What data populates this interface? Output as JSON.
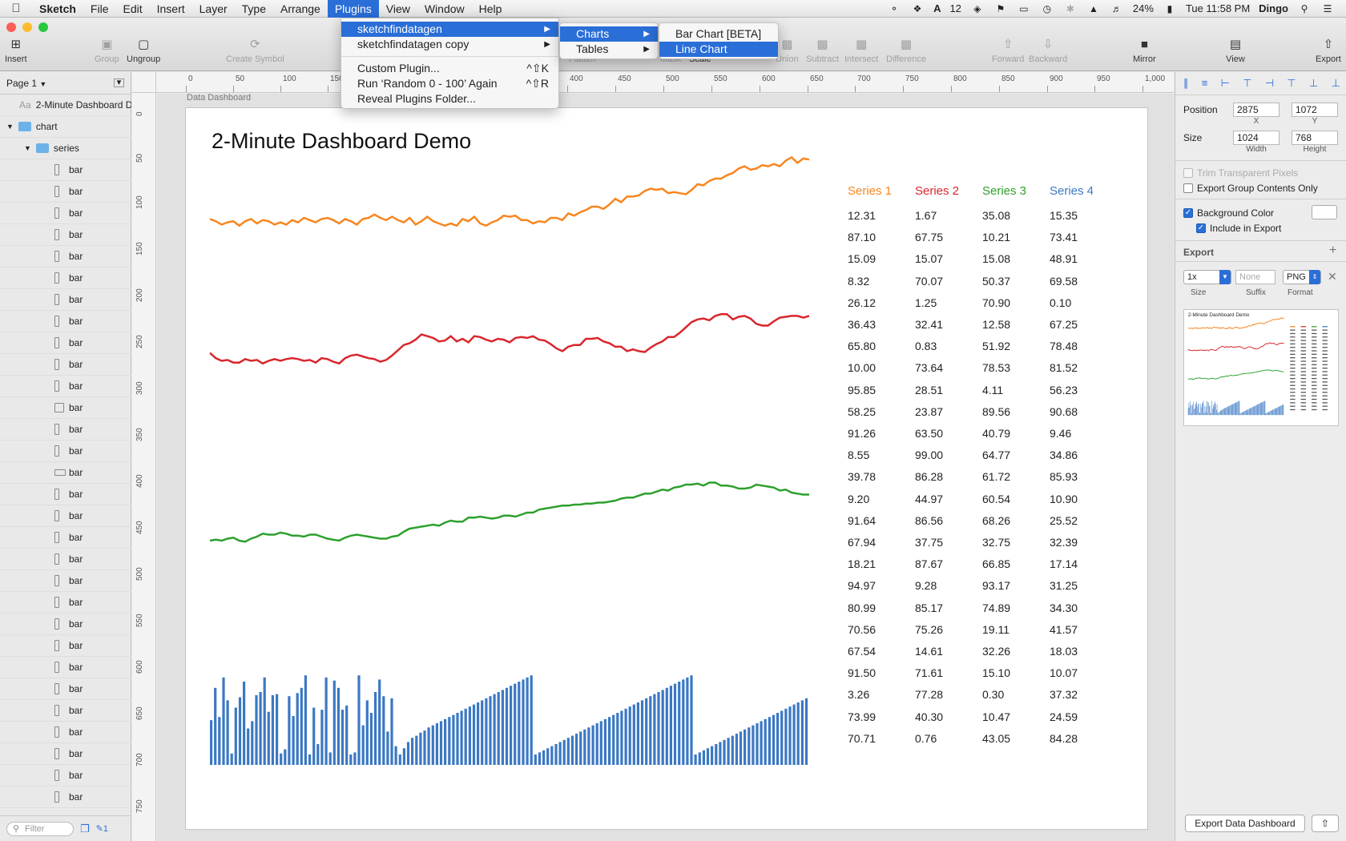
{
  "menubar": {
    "app": "Sketch",
    "items": [
      "File",
      "Edit",
      "Insert",
      "Layer",
      "Type",
      "Arrange",
      "Plugins",
      "View",
      "Window",
      "Help"
    ],
    "badge": "12",
    "battery": "24%",
    "clock": "Tue 11:58 PM",
    "user": "Dingo"
  },
  "toolbar": {
    "insert": "Insert",
    "group": "Group",
    "ungroup": "Ungroup",
    "create_symbol": "Create Symbol",
    "flatten": "Flatten",
    "mask": "Mask",
    "scale": "Scale",
    "union": "Union",
    "subtract": "Subtract",
    "intersect": "Intersect",
    "difference": "Difference",
    "forward": "Forward",
    "backward": "Backward",
    "mirror": "Mirror",
    "view": "View",
    "export": "Export"
  },
  "left": {
    "page": "Page 1",
    "text_layer": "2-Minute Dashboard D",
    "folder1": "chart",
    "folder2": "series",
    "bar_label": "bar",
    "filter_placeholder": "Filter",
    "footer_count": "1"
  },
  "ruler_top": [
    "0",
    "50",
    "100",
    "150",
    "400",
    "450",
    "500",
    "550",
    "600",
    "650",
    "700",
    "750",
    "800",
    "850",
    "900",
    "950",
    "1,000"
  ],
  "ruler_left": [
    "0",
    "50",
    "100",
    "150",
    "200",
    "250",
    "300",
    "350",
    "400",
    "450",
    "500",
    "550",
    "600",
    "650",
    "700",
    "750"
  ],
  "artboard": {
    "label": "Data Dashboard",
    "title": "2-Minute Dashboard Demo"
  },
  "menus": {
    "plugins": {
      "items": [
        "sketchfindatagen",
        "sketchfindatagen copy",
        "Custom Plugin...",
        "Run ‘Random 0 - 100’ Again",
        "Reveal Plugins Folder..."
      ],
      "shortcuts": [
        "^⇧K",
        "^⇧R"
      ]
    },
    "sub1": [
      "Charts",
      "Tables"
    ],
    "sub2": [
      "Bar Chart [BETA]",
      "Line Chart"
    ]
  },
  "inspector": {
    "position": "Position",
    "x": "2875",
    "y": "1072",
    "x_label": "X",
    "y_label": "Y",
    "size": "Size",
    "w": "1024",
    "h": "768",
    "w_label": "Width",
    "h_label": "Height",
    "trim": "Trim Transparent Pixels",
    "export_group": "Export Group Contents Only",
    "bg_color": "Background Color",
    "include": "Include in Export",
    "export": "Export",
    "size_val": "1x",
    "suffix_placeholder": "None",
    "format": "PNG",
    "size_lbl": "Size",
    "suffix_lbl": "Suffix",
    "format_lbl": "Format",
    "export_btn": "Export Data Dashboard"
  },
  "colors": {
    "s1": "#f7861f",
    "s2": "#d9262c",
    "s3": "#2ca02c",
    "s4": "#3b78c3"
  },
  "chart_data": [
    {
      "type": "line",
      "series": [
        {
          "values": [
            56,
            58,
            61,
            59,
            58,
            62,
            58,
            56,
            60,
            57,
            58,
            61,
            59,
            61,
            57,
            59,
            55,
            57,
            59,
            56,
            55,
            57,
            60,
            56,
            58,
            61,
            56,
            55,
            52,
            55,
            57,
            54,
            57,
            59,
            55,
            61,
            58,
            54,
            58,
            60,
            62,
            60,
            62,
            56,
            58,
            54,
            60,
            62,
            59,
            57,
            53,
            54,
            53,
            57,
            57,
            60,
            58,
            59,
            55,
            55,
            57,
            51,
            53,
            50,
            48,
            45,
            45,
            47,
            43,
            38,
            41,
            36,
            36,
            35,
            31,
            29,
            30,
            29,
            33,
            32,
            33,
            34,
            30,
            25,
            26,
            22,
            20,
            20,
            17,
            15,
            11,
            9,
            12,
            11,
            8,
            9,
            7,
            9,
            4,
            1,
            6,
            2,
            3
          ]
        }
      ]
    },
    {
      "type": "line",
      "series": [
        {
          "values": [
            46,
            52,
            55,
            54,
            57,
            57,
            53,
            55,
            54,
            58,
            55,
            53,
            55,
            53,
            52,
            53,
            55,
            54,
            57,
            52,
            53,
            56,
            58,
            52,
            49,
            48,
            50,
            52,
            53,
            56,
            54,
            49,
            43,
            37,
            35,
            31,
            25,
            27,
            29,
            33,
            32,
            27,
            33,
            30,
            34,
            27,
            28,
            31,
            33,
            30,
            31,
            34,
            29,
            28,
            29,
            27,
            31,
            32,
            36,
            41,
            44,
            39,
            37,
            37,
            30,
            30,
            29,
            33,
            35,
            39,
            39,
            44,
            42,
            44,
            45,
            40,
            36,
            33,
            28,
            28,
            23,
            17,
            11,
            8,
            7,
            9,
            4,
            2,
            2,
            8,
            5,
            4,
            7,
            13,
            15,
            15,
            10,
            6,
            5,
            4,
            4,
            6,
            4
          ]
        }
      ]
    },
    {
      "type": "line",
      "series": [
        {
          "values": [
            72,
            71,
            72,
            70,
            69,
            72,
            73,
            70,
            68,
            65,
            66,
            66,
            64,
            65,
            67,
            67,
            68,
            66,
            66,
            68,
            70,
            71,
            72,
            69,
            67,
            66,
            67,
            68,
            69,
            70,
            70,
            68,
            67,
            63,
            60,
            59,
            58,
            57,
            56,
            57,
            54,
            52,
            53,
            53,
            49,
            49,
            48,
            49,
            50,
            49,
            47,
            47,
            48,
            46,
            44,
            44,
            41,
            40,
            39,
            38,
            37,
            37,
            36,
            36,
            35,
            35,
            34,
            34,
            33,
            32,
            30,
            29,
            29,
            27,
            25,
            25,
            23,
            21,
            22,
            19,
            18,
            16,
            16,
            15,
            17,
            14,
            14,
            17,
            17,
            18,
            20,
            20,
            19,
            16,
            17,
            18,
            19,
            22,
            21,
            24,
            25,
            26,
            26
          ]
        }
      ]
    },
    {
      "type": "bar",
      "series": [
        {
          "values": [
            43,
            74,
            46,
            84,
            62,
            11,
            55,
            65,
            80,
            35,
            42,
            67,
            70,
            84,
            51,
            67,
            68,
            11,
            15,
            66,
            47,
            69,
            74,
            86,
            10,
            55,
            20,
            53,
            84,
            12,
            81,
            74,
            53,
            57,
            10,
            12,
            86,
            38,
            62,
            50,
            70,
            82,
            66,
            32,
            64,
            18,
            10,
            16,
            22,
            26,
            28,
            31,
            33,
            36,
            38,
            40,
            42,
            44,
            46,
            48,
            50,
            52,
            54,
            56,
            58,
            60,
            62,
            64,
            66,
            68,
            70,
            72,
            74,
            76,
            78,
            80,
            82,
            84,
            86,
            10,
            12,
            14,
            16,
            18,
            20,
            22,
            24,
            26,
            28,
            30,
            32,
            34,
            36,
            38,
            40,
            42,
            44,
            46,
            48,
            50,
            52,
            54,
            56,
            58,
            60,
            62,
            64,
            66,
            68,
            70,
            72,
            74,
            76,
            78,
            80,
            82,
            84,
            86,
            10,
            12,
            14,
            16,
            18,
            20,
            22,
            24,
            26,
            28,
            30,
            32,
            34,
            36,
            38,
            40,
            42,
            44,
            46,
            48,
            50,
            52,
            54,
            56,
            58,
            60,
            62,
            64
          ]
        }
      ]
    },
    {
      "type": "table",
      "columns": [
        "Series 1",
        "Series 2",
        "Series 3",
        "Series 4"
      ],
      "rows": [
        [
          "12.31",
          "1.67",
          "35.08",
          "15.35"
        ],
        [
          "87.10",
          "67.75",
          "10.21",
          "73.41"
        ],
        [
          "15.09",
          "15.07",
          "15.08",
          "48.91"
        ],
        [
          "8.32",
          "70.07",
          "50.37",
          "69.58"
        ],
        [
          "26.12",
          "1.25",
          "70.90",
          "0.10"
        ],
        [
          "36.43",
          "32.41",
          "12.58",
          "67.25"
        ],
        [
          "65.80",
          "0.83",
          "51.92",
          "78.48"
        ],
        [
          "10.00",
          "73.64",
          "78.53",
          "81.52"
        ],
        [
          "95.85",
          "28.51",
          "4.11",
          "56.23"
        ],
        [
          "58.25",
          "23.87",
          "89.56",
          "90.68"
        ],
        [
          "91.26",
          "63.50",
          "40.79",
          "9.46"
        ],
        [
          "8.55",
          "99.00",
          "64.77",
          "34.86"
        ],
        [
          "39.78",
          "86.28",
          "61.72",
          "85.93"
        ],
        [
          "9.20",
          "44.97",
          "60.54",
          "10.90"
        ],
        [
          "91.64",
          "86.56",
          "68.26",
          "25.52"
        ],
        [
          "67.94",
          "37.75",
          "32.75",
          "32.39"
        ],
        [
          "18.21",
          "87.67",
          "66.85",
          "17.14"
        ],
        [
          "94.97",
          "9.28",
          "93.17",
          "31.25"
        ],
        [
          "80.99",
          "85.17",
          "74.89",
          "34.30"
        ],
        [
          "70.56",
          "75.26",
          "19.11",
          "41.57"
        ],
        [
          "67.54",
          "14.61",
          "32.26",
          "18.03"
        ],
        [
          "91.50",
          "71.61",
          "15.10",
          "10.07"
        ],
        [
          "3.26",
          "77.28",
          "0.30",
          "37.32"
        ],
        [
          "73.99",
          "40.30",
          "10.47",
          "24.59"
        ],
        [
          "70.71",
          "0.76",
          "43.05",
          "84.28"
        ]
      ]
    }
  ]
}
